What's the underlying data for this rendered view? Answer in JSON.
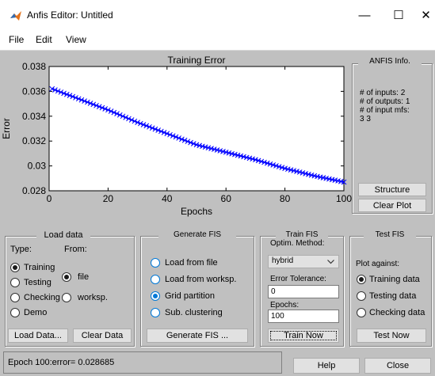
{
  "window": {
    "title": "Anfis Editor: Untitled",
    "minimize": "—",
    "maximize": "☐",
    "close": "✕",
    "icon": "matlab-icon"
  },
  "menu": [
    "File",
    "Edit",
    "View"
  ],
  "chart_data": {
    "type": "line",
    "title": "Training Error",
    "xlabel": "Epochs",
    "ylabel": "Error",
    "xlim": [
      0,
      100
    ],
    "ylim": [
      0.028,
      0.038
    ],
    "x_ticks": [
      "0",
      "20",
      "40",
      "60",
      "80",
      "100"
    ],
    "y_ticks": [
      "0.028",
      "0.03",
      "0.032",
      "0.034",
      "0.036",
      "0.038"
    ],
    "series": [
      {
        "x": [
          1,
          10,
          20,
          30,
          40,
          50,
          60,
          70,
          80,
          90,
          100
        ],
        "y": [
          0.0362,
          0.0354,
          0.0345,
          0.0335,
          0.0326,
          0.0317,
          0.0311,
          0.0305,
          0.0298,
          0.0292,
          0.0287
        ],
        "color": "#0000ff",
        "marker": "x"
      }
    ],
    "grid": false
  },
  "anfis_info": {
    "title": "ANFIS Info.",
    "lines": [
      "# of inputs: 2",
      "# of outputs: 1",
      "# of input mfs:",
      "3 3"
    ],
    "structure_button": "Structure",
    "clear_plot_button": "Clear Plot"
  },
  "load_data": {
    "title": "Load data",
    "type_label": "Type:",
    "from_label": "From:",
    "types": [
      "Training",
      "Testing",
      "Checking",
      "Demo"
    ],
    "type_selected": "Training",
    "sources": [
      "file",
      "worksp."
    ],
    "source_selected": "file",
    "load_button": "Load Data...",
    "clear_button": "Clear Data"
  },
  "generate_fis": {
    "title": "Generate FIS",
    "options": [
      "Load from file",
      "Load from worksp.",
      "Grid partition",
      "Sub. clustering"
    ],
    "selected": "Grid partition",
    "button": "Generate FIS ..."
  },
  "train_fis": {
    "title": "Train FIS",
    "method_label": "Optim. Method:",
    "method_value": "hybrid",
    "tolerance_label": "Error Tolerance:",
    "tolerance_value": "0",
    "epochs_label": "Epochs:",
    "epochs_value": "100",
    "button": "Train Now"
  },
  "test_fis": {
    "title": "Test FIS",
    "plot_against_label": "Plot against:",
    "options": [
      "Training data",
      "Testing data",
      "Checking data"
    ],
    "selected": "Training data",
    "button": "Test Now"
  },
  "status": {
    "text": "Epoch 100:error= 0.028685",
    "help_button": "Help",
    "close_button": "Close"
  },
  "colors": {
    "figure_bg": "#c0c0c0",
    "plot_line": "#0000ff",
    "radio_accent": "#0078d7"
  }
}
